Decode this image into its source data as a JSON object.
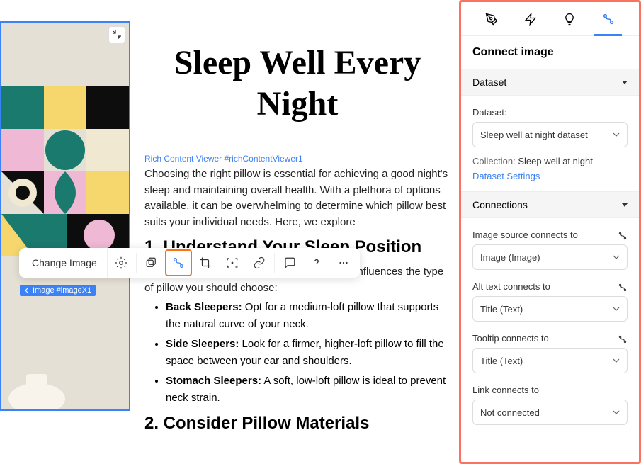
{
  "article": {
    "title": "Sleep Well Every Night",
    "viewer_label": "Rich Content Viewer #richContentViewer1",
    "intro": "Choosing the right pillow is essential for achieving a good night's sleep and maintaining overall health. With a plethora of options available, it can be overwhelming to determine which pillow best suits your individual needs. Here, we explore",
    "heading1": "1. Understand Your Sleep Position",
    "para1": "Your preferred sleeping position significantly influences the type of pillow you should choose:",
    "list": [
      {
        "bold": "Back Sleepers:",
        "text": " Opt for a medium-loft pillow that supports the natural curve of your neck."
      },
      {
        "bold": "Side Sleepers:",
        "text": " Look for a firmer, higher-loft pillow to fill the space between your ear and shoulders."
      },
      {
        "bold": "Stomach Sleepers:",
        "text": " A soft, low-loft pillow is ideal to prevent neck strain."
      }
    ],
    "heading2": "2. Consider Pillow Materials"
  },
  "toolbar": {
    "change_image": "Change Image"
  },
  "image_tag": "Image #imageX1",
  "panel": {
    "title": "Connect image",
    "dataset": {
      "header": "Dataset",
      "label": "Dataset:",
      "value": "Sleep well at night dataset",
      "collection_label": "Collection:",
      "collection_value": "Sleep well at night",
      "settings_link": "Dataset Settings"
    },
    "connections": {
      "header": "Connections",
      "fields": [
        {
          "label": "Image source connects to",
          "value": "Image (Image)"
        },
        {
          "label": "Alt text connects to",
          "value": "Title (Text)"
        },
        {
          "label": "Tooltip connects to",
          "value": "Title (Text)"
        },
        {
          "label": "Link connects to",
          "value": "Not connected"
        }
      ]
    }
  }
}
